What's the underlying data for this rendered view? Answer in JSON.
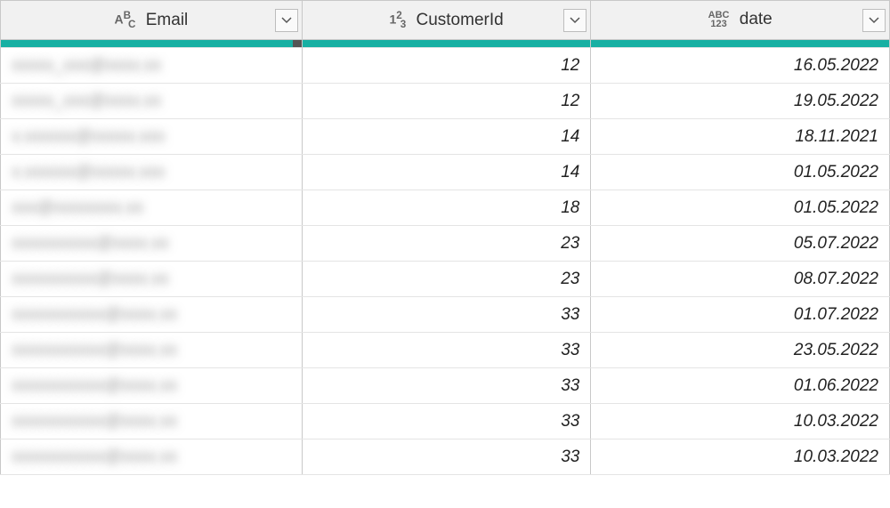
{
  "columns": [
    {
      "type_label": "AᴮC",
      "name": "Email"
    },
    {
      "type_label": "1²3",
      "name": "CustomerId"
    },
    {
      "type_label": "ABC 123",
      "name": "date"
    }
  ],
  "quality": {
    "email_has_error": true
  },
  "rows": [
    {
      "email": "xxxxx_xxx@xxxx.xx",
      "cid": "12",
      "date": "16.05.2022"
    },
    {
      "email": "xxxxx_xxx@xxxx.xx",
      "cid": "12",
      "date": "19.05.2022"
    },
    {
      "email": "x.xxxxxx@xxxxx.xxx",
      "cid": "14",
      "date": "18.11.2021"
    },
    {
      "email": "x.xxxxxx@xxxxx.xxx",
      "cid": "14",
      "date": "01.05.2022"
    },
    {
      "email": "xxx@xxxxxxxx.xx",
      "cid": "18",
      "date": "01.05.2022"
    },
    {
      "email": "xxxxxxxxxx@xxxx.xx",
      "cid": "23",
      "date": "05.07.2022"
    },
    {
      "email": "xxxxxxxxxx@xxxx.xx",
      "cid": "23",
      "date": "08.07.2022"
    },
    {
      "email": "xxxxxxxxxxx@xxxx.xx",
      "cid": "33",
      "date": "01.07.2022"
    },
    {
      "email": "xxxxxxxxxxx@xxxx.xx",
      "cid": "33",
      "date": "23.05.2022"
    },
    {
      "email": "xxxxxxxxxxx@xxxx.xx",
      "cid": "33",
      "date": "01.06.2022"
    },
    {
      "email": "xxxxxxxxxxx@xxxx.xx",
      "cid": "33",
      "date": "10.03.2022"
    },
    {
      "email": "xxxxxxxxxxx@xxxx.xx",
      "cid": "33",
      "date": "10.03.2022"
    }
  ]
}
